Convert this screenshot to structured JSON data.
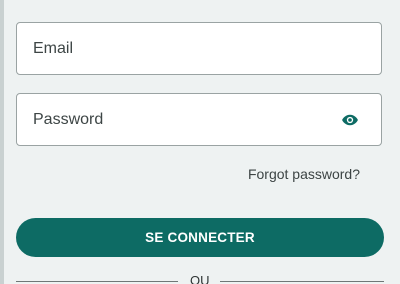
{
  "login_form": {
    "email": {
      "placeholder": "Email",
      "value": ""
    },
    "password": {
      "placeholder": "Password",
      "value": "",
      "visibility_icon": "eye-icon"
    },
    "forgot_password_link": "Forgot password?",
    "submit_button": "SE CONNECTER",
    "divider_text": "OU"
  },
  "colors": {
    "primary": "#0d6b64",
    "background": "#eef2f2",
    "field_border": "#9aa3a3"
  }
}
